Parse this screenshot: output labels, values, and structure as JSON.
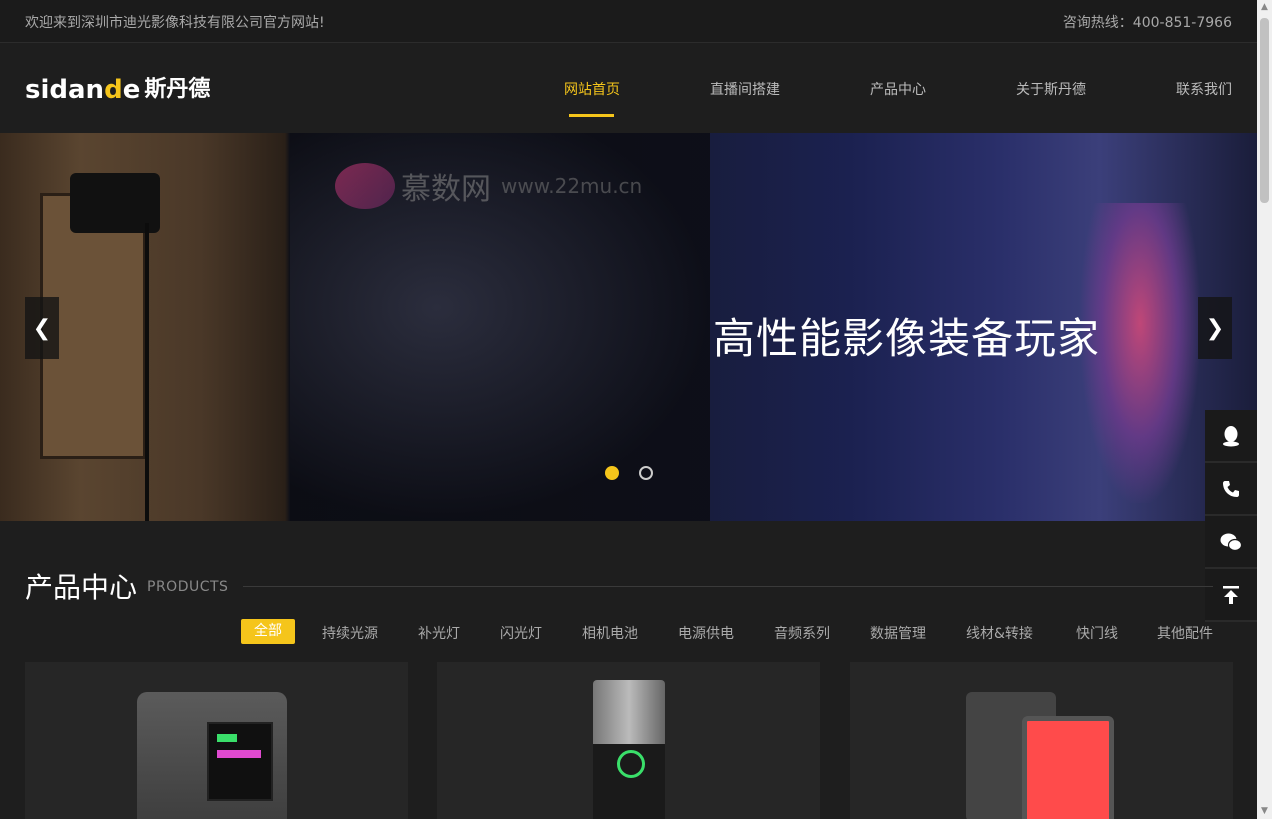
{
  "topbar": {
    "welcome": "欢迎来到深圳市迪光影像科技有限公司官方网站!",
    "hotline": "咨询热线：400-851-7966"
  },
  "logo": {
    "latin_a": "sidan",
    "latin_mark": "d",
    "latin_b": "e",
    "cn": "斯丹德"
  },
  "nav": {
    "items": [
      "网站首页",
      "直播间搭建",
      "产品中心",
      "关于斯丹德",
      "联系我们"
    ],
    "active": "网站首页"
  },
  "banner": {
    "slogan": "高性能影像装备玩家",
    "watermark_cn": "慕数网",
    "watermark_url": "www.22mu.cn",
    "slide_count": 2,
    "active_slide": 1
  },
  "sidebar": {
    "icons": [
      "qq-icon",
      "phone-icon",
      "wechat-icon",
      "back-to-top-icon"
    ]
  },
  "products": {
    "title": "产品中心",
    "subtitle": "PRODUCTS",
    "tabs": [
      "全部",
      "持续光源",
      "补光灯",
      "闪光灯",
      "相机电池",
      "电源供电",
      "音频系列",
      "数据管理",
      "线材&转接",
      "快门线",
      "其他配件"
    ],
    "active_tab": "全部"
  },
  "colors": {
    "accent": "#f5c51b",
    "background": "#1e1e1e"
  }
}
